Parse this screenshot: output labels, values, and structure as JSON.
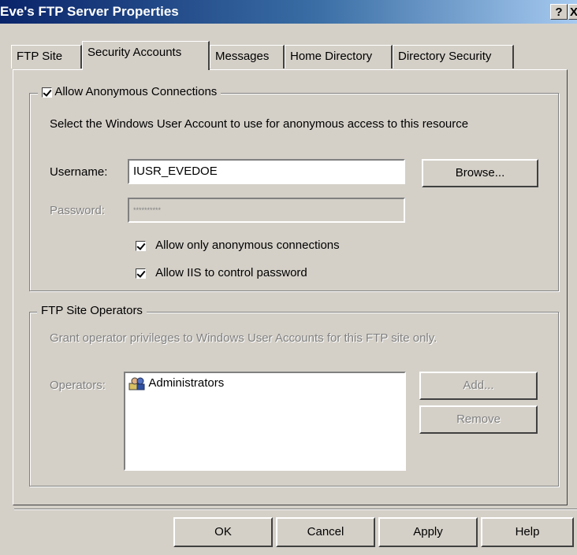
{
  "window": {
    "title": "Eve's FTP Server Properties",
    "help_glyph": "?",
    "close_glyph": "X"
  },
  "tabs": [
    {
      "label": "FTP Site"
    },
    {
      "label": "Security Accounts"
    },
    {
      "label": "Messages"
    },
    {
      "label": "Home Directory"
    },
    {
      "label": "Directory Security"
    }
  ],
  "anonymous": {
    "group_label": "Allow Anonymous Connections",
    "checked": true,
    "description": "Select the Windows User Account to use for anonymous access to this resource",
    "username_label": "Username:",
    "username_value": "IUSR_EVEDOE",
    "browse_label": "Browse...",
    "password_label": "Password:",
    "password_value": "**********",
    "only_anon_label": "Allow only anonymous connections",
    "only_anon_checked": true,
    "iis_control_label": "Allow IIS to control password",
    "iis_control_checked": true
  },
  "operators": {
    "group_label": "FTP Site Operators",
    "description": "Grant operator privileges to Windows User Accounts for this FTP site only.",
    "operators_label": "Operators:",
    "items": [
      "Administrators"
    ],
    "add_label": "Add...",
    "remove_label": "Remove"
  },
  "footer": {
    "ok": "OK",
    "cancel": "Cancel",
    "apply": "Apply",
    "help": "Help"
  }
}
